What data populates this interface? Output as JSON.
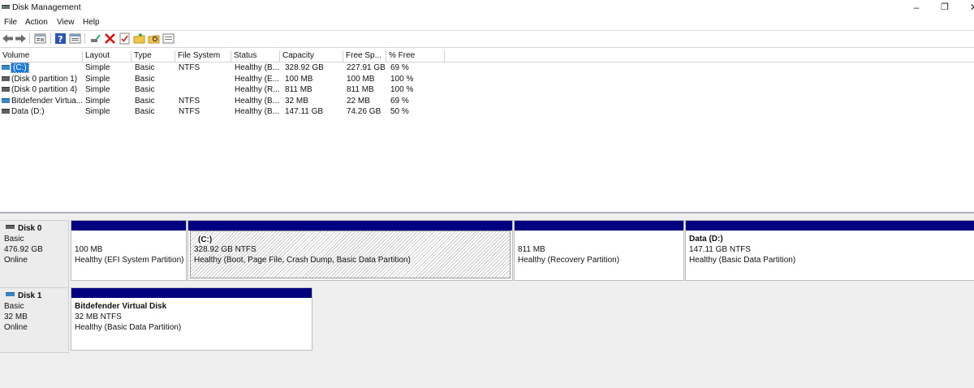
{
  "window": {
    "title": "Disk Management"
  },
  "menu": [
    "File",
    "Action",
    "View",
    "Help"
  ],
  "toolbar": [
    "back-arrow-icon",
    "forward-arrow-icon",
    "disk-list-icon",
    "help-icon",
    "properties-icon",
    "connect-icon",
    "delete-icon",
    "check-icon",
    "new-folder-icon",
    "search-folder-icon",
    "rescan-icon"
  ],
  "columns": [
    "Volume",
    "Layout",
    "Type",
    "File System",
    "Status",
    "Capacity",
    "Free Sp...",
    "% Free"
  ],
  "volumes": [
    {
      "name": "(C:)",
      "layout": "Simple",
      "type": "Basic",
      "fs": "NTFS",
      "status": "Healthy (B...",
      "capacity": "328.92 GB",
      "free": "227.91 GB",
      "pct": "69 %",
      "selected": true
    },
    {
      "name": "(Disk 0 partition 1)",
      "layout": "Simple",
      "type": "Basic",
      "fs": "",
      "status": "Healthy (E...",
      "capacity": "100 MB",
      "free": "100 MB",
      "pct": "100 %"
    },
    {
      "name": "(Disk 0 partition 4)",
      "layout": "Simple",
      "type": "Basic",
      "fs": "",
      "status": "Healthy (R...",
      "capacity": "811 MB",
      "free": "811 MB",
      "pct": "100 %"
    },
    {
      "name": "Bitdefender Virtua...",
      "layout": "Simple",
      "type": "Basic",
      "fs": "NTFS",
      "status": "Healthy (B...",
      "capacity": "32 MB",
      "free": "22 MB",
      "pct": "69 %"
    },
    {
      "name": "Data (D:)",
      "layout": "Simple",
      "type": "Basic",
      "fs": "NTFS",
      "status": "Healthy (B...",
      "capacity": "147.11 GB",
      "free": "74.26 GB",
      "pct": "50 %"
    }
  ],
  "disks": [
    {
      "name": "Disk 0",
      "type": "Basic",
      "size": "476.92 GB",
      "state": "Online",
      "partitions": [
        {
          "title": "",
          "size": "100 MB",
          "status": "Healthy (EFI System Partition)"
        },
        {
          "title": "(C:)",
          "size": "328.92 GB NTFS",
          "status": "Healthy (Boot, Page File, Crash Dump, Basic Data Partition)"
        },
        {
          "title": "",
          "size": "811 MB",
          "status": "Healthy (Recovery Partition)"
        },
        {
          "title": "Data  (D:)",
          "size": "147.11 GB NTFS",
          "status": "Healthy (Basic Data Partition)"
        }
      ]
    },
    {
      "name": "Disk 1",
      "type": "Basic",
      "size": "32 MB",
      "state": "Online",
      "partitions": [
        {
          "title": "Bitdefender Virtual Disk",
          "size": "32 MB NTFS",
          "status": "Healthy (Basic Data Partition)"
        }
      ]
    }
  ],
  "colors": {
    "primary_partition_bar": "#000080",
    "selection": "#1f7ad6"
  }
}
